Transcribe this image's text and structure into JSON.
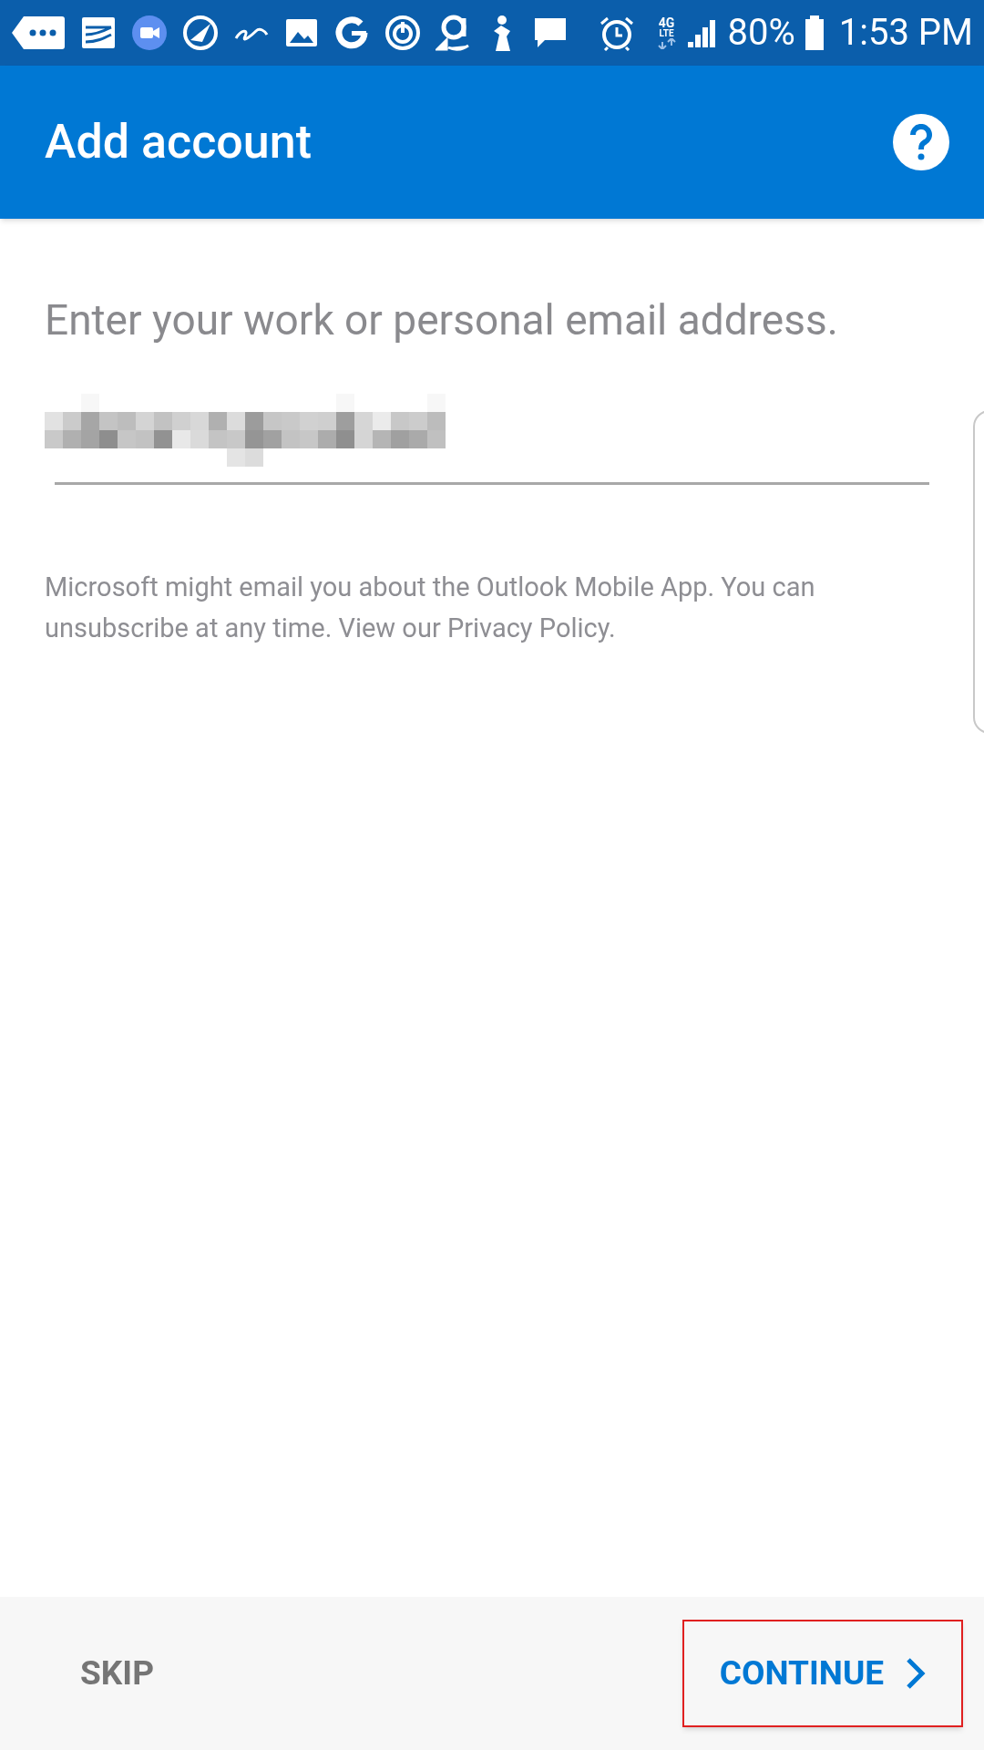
{
  "status_bar": {
    "network": "4G",
    "network_sub": "LTE",
    "battery": "80%",
    "time": "1:53 PM"
  },
  "app_bar": {
    "title": "Add account"
  },
  "prompt": "Enter your work or personal email address.",
  "email_field": {
    "redacted": true
  },
  "disclaimer": "Microsoft might email you about the Outlook Mobile App. You can unsubscribe at any time. View our Privacy Policy.",
  "footer": {
    "buttons": [
      {
        "label": "SKIP",
        "kind": "secondary",
        "highlighted": false
      },
      {
        "label": "CONTINUE",
        "kind": "primary",
        "highlighted": true
      }
    ]
  }
}
